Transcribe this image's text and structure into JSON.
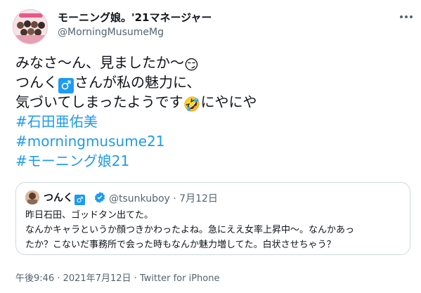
{
  "author": {
    "display_name": "モーニング娘。'21マネージャー",
    "handle": "@MorningMusumeMg"
  },
  "tweet": {
    "line1": "みなさ〜ん、見ましたか〜",
    "line1_emoji": "😏",
    "line2_a": "つんく",
    "line2_emoji": "♂",
    "line2_b": "さんが私の魅力に、",
    "line3_a": "気づいてしまったようです",
    "line3_emoji": "🤣",
    "line3_b": "にやにや",
    "hashtags": [
      "#石田亜佑美",
      "#morningmusume21",
      "#モーニング娘21"
    ]
  },
  "quote": {
    "name": "つんく",
    "name_emoji": "♂",
    "handle_date": "@tsunkuboy · 7月12日",
    "lines": [
      "昨日石田、ゴッドタン出てた。",
      "なんかキャラというか顔つきかわったよね。急にええ女率上昇中〜。なんかあっ",
      "たか？こないだ事務所で会った時もなんか魅力増してた。白状させちゃう？"
    ]
  },
  "meta": {
    "time": "午後9:46 · 2021年7月12日 · ",
    "source": "Twitter for iPhone"
  },
  "icons": {
    "more": "more-icon",
    "verified": "verified-icon",
    "accent": "#1d9bf0"
  }
}
